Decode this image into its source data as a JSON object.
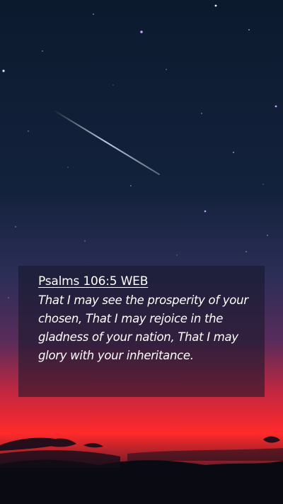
{
  "verse": {
    "reference": "Psalms 106:5 WEB",
    "text": "That I may see the prosperity of your chosen, That I may rejoice in the gladness of your nation, That I may glory with your inheritance."
  },
  "scene": {
    "sky_top": "#0c1a2e",
    "sky_mid": "#2c2e57",
    "horizon_glow": "#ff2a2a",
    "ground": "#0a0a12"
  }
}
